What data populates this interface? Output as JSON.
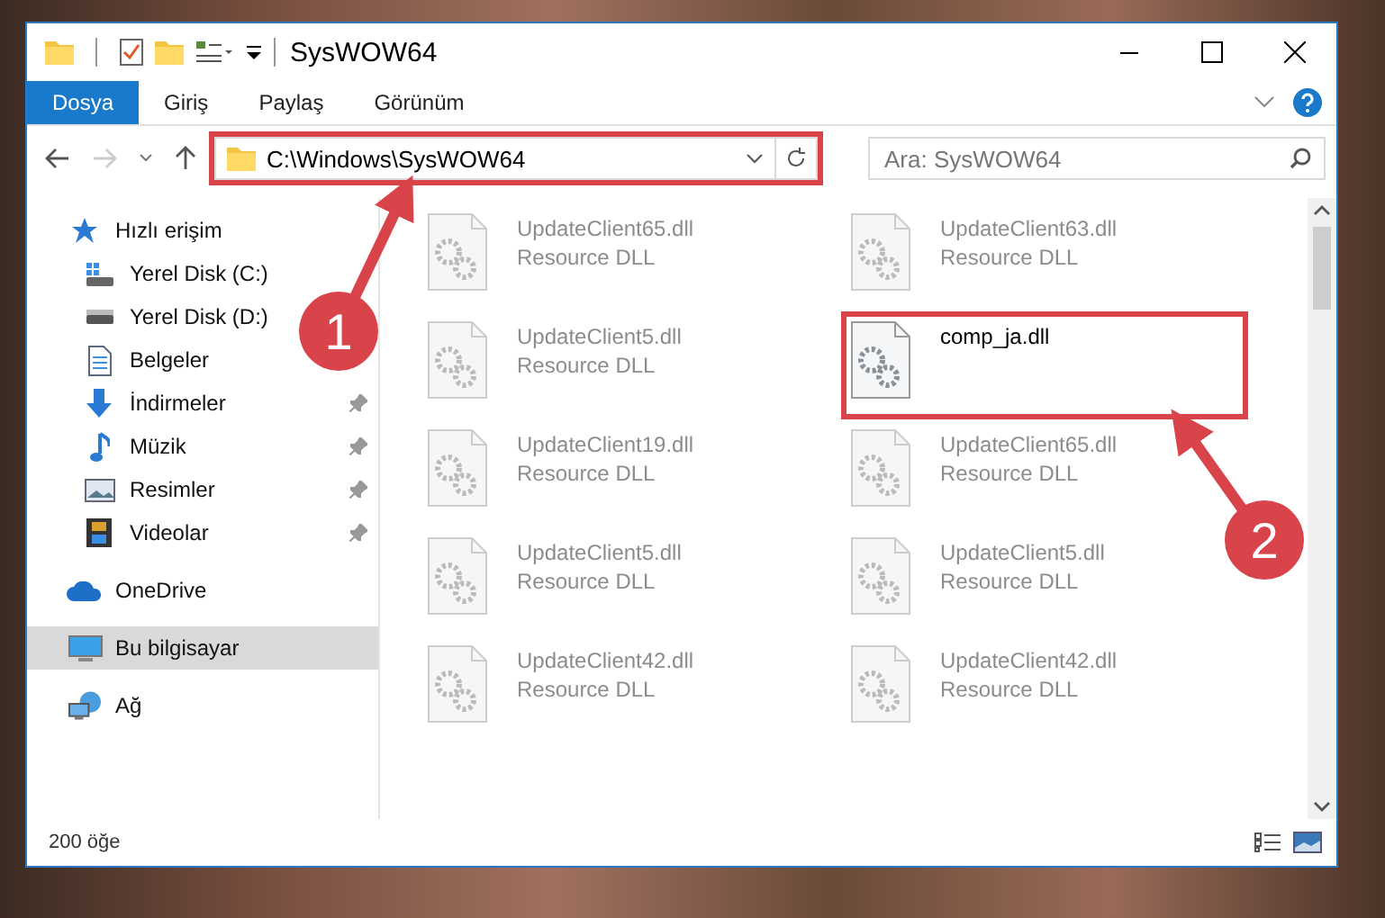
{
  "window": {
    "title": "SysWOW64"
  },
  "ribbon": {
    "tabs": [
      {
        "label": "Dosya",
        "selected": true
      },
      {
        "label": "Giriş",
        "selected": false
      },
      {
        "label": "Paylaş",
        "selected": false
      },
      {
        "label": "Görünüm",
        "selected": false
      }
    ]
  },
  "address_bar": {
    "path": "C:\\Windows\\SysWOW64",
    "highlighted": true
  },
  "search": {
    "placeholder": "Ara: SysWOW64"
  },
  "sidebar": {
    "items": [
      {
        "label": "Hızlı erişim",
        "kind": "star",
        "selected": false,
        "pinned": false,
        "children": [
          {
            "label": "Yerel Disk (C:)",
            "kind": "system-drive",
            "selected": false,
            "pinned": false
          },
          {
            "label": "Yerel Disk (D:)",
            "kind": "drive",
            "selected": false,
            "pinned": false
          },
          {
            "label": "Belgeler",
            "kind": "document",
            "selected": false,
            "pinned": false
          },
          {
            "label": "İndirmeler",
            "kind": "download",
            "selected": false,
            "pinned": true
          },
          {
            "label": "Müzik",
            "kind": "music",
            "selected": false,
            "pinned": true
          },
          {
            "label": "Resimler",
            "kind": "picture",
            "selected": false,
            "pinned": true
          },
          {
            "label": "Videolar",
            "kind": "video",
            "selected": false,
            "pinned": true
          }
        ]
      },
      {
        "label": "OneDrive",
        "kind": "cloud",
        "selected": false,
        "pinned": false
      },
      {
        "label": "Bu bilgisayar",
        "kind": "computer",
        "selected": true,
        "pinned": false
      },
      {
        "label": "Ağ",
        "kind": "network",
        "selected": false,
        "pinned": false
      }
    ]
  },
  "files": [
    {
      "name": "UpdateClient65.dll",
      "type": "Resource DLL",
      "blurred": true,
      "highlighted": false
    },
    {
      "name": "UpdateClient63.dll",
      "type": "Resource DLL",
      "blurred": true,
      "highlighted": false
    },
    {
      "name": "UpdateClient5.dll",
      "type": "Resource DLL",
      "blurred": true,
      "highlighted": false
    },
    {
      "name": "comp_ja.dll",
      "blurred": false,
      "highlighted": true
    },
    {
      "name": "UpdateClient19.dll",
      "type": "Resource DLL",
      "blurred": true,
      "highlighted": false
    },
    {
      "name": "UpdateClient65.dll",
      "type": "Resource DLL",
      "blurred": true,
      "highlighted": false
    },
    {
      "name": "UpdateClient5.dll",
      "type": "Resource DLL",
      "blurred": true,
      "highlighted": false
    },
    {
      "name": "UpdateClient5.dll",
      "type": "Resource DLL",
      "blurred": true,
      "highlighted": false
    },
    {
      "name": "UpdateClient42.dll",
      "type": "Resource DLL",
      "blurred": true,
      "highlighted": false
    },
    {
      "name": "UpdateClient42.dll",
      "type": "Resource DLL",
      "blurred": true,
      "highlighted": false
    }
  ],
  "status_bar": {
    "item_count": "200 öğe"
  },
  "callouts": [
    {
      "number": "1"
    },
    {
      "number": "2"
    }
  ]
}
